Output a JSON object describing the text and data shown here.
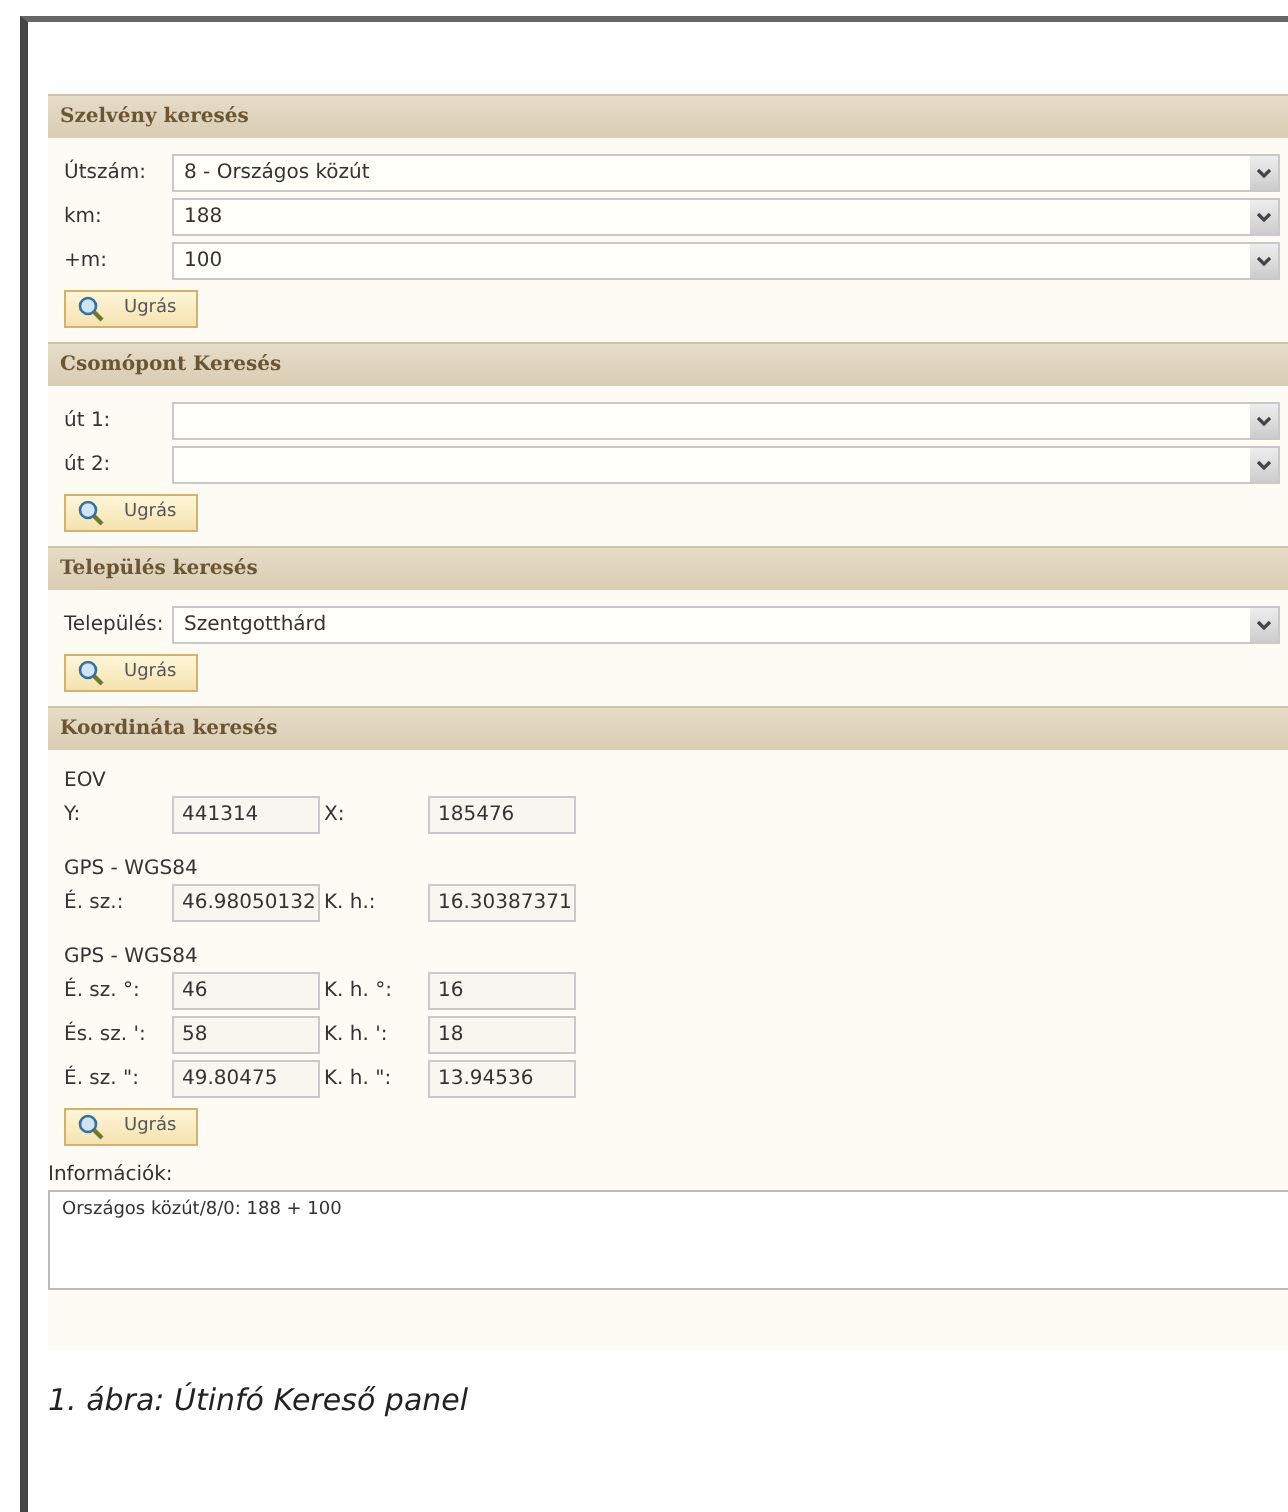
{
  "sections": [
    {
      "title": "Szelvény keresés",
      "kind": "selects",
      "rows": [
        {
          "label": "Útszám:",
          "value": "8 - Országos közút"
        },
        {
          "label": "km:",
          "value": "188"
        },
        {
          "label": "+m:",
          "value": "100"
        }
      ],
      "button": "Ugrás"
    },
    {
      "title": "Csomópont Keresés",
      "kind": "selects",
      "rows": [
        {
          "label": "út 1:",
          "value": ""
        },
        {
          "label": "út 2:",
          "value": ""
        }
      ],
      "button": "Ugrás"
    },
    {
      "title": "Település keresés",
      "kind": "selects",
      "rows": [
        {
          "label": "Település:",
          "value": "Szentgotthárd"
        }
      ],
      "button": "Ugrás"
    },
    {
      "title": "Koordináta keresés",
      "kind": "coords",
      "groups": [
        {
          "heading": "EOV",
          "rows": [
            {
              "label_a": "Y:",
              "value_a": "441314",
              "label_b": "X:",
              "value_b": "185476"
            }
          ]
        },
        {
          "heading": "GPS - WGS84",
          "rows": [
            {
              "label_a": "É. sz.:",
              "value_a": "46.98050132",
              "label_b": "K. h.:",
              "value_b": "16.30387371"
            }
          ]
        },
        {
          "heading": "GPS - WGS84",
          "rows": [
            {
              "label_a": "É. sz. °:",
              "value_a": "46",
              "label_b": "K. h. °:",
              "value_b": "16"
            },
            {
              "label_a": "És. sz. ':",
              "value_a": "58",
              "label_b": "K. h. ':",
              "value_b": "18"
            },
            {
              "label_a": "É. sz. \":",
              "value_a": "49.80475",
              "label_b": "K. h. \":",
              "value_b": "13.94536"
            }
          ]
        }
      ],
      "button": "Ugrás"
    }
  ],
  "info": {
    "label": "Információk:",
    "text": "Országos közút/8/0: 188 + 100"
  },
  "caption": "1. ábra: Útinfó Kereső panel"
}
